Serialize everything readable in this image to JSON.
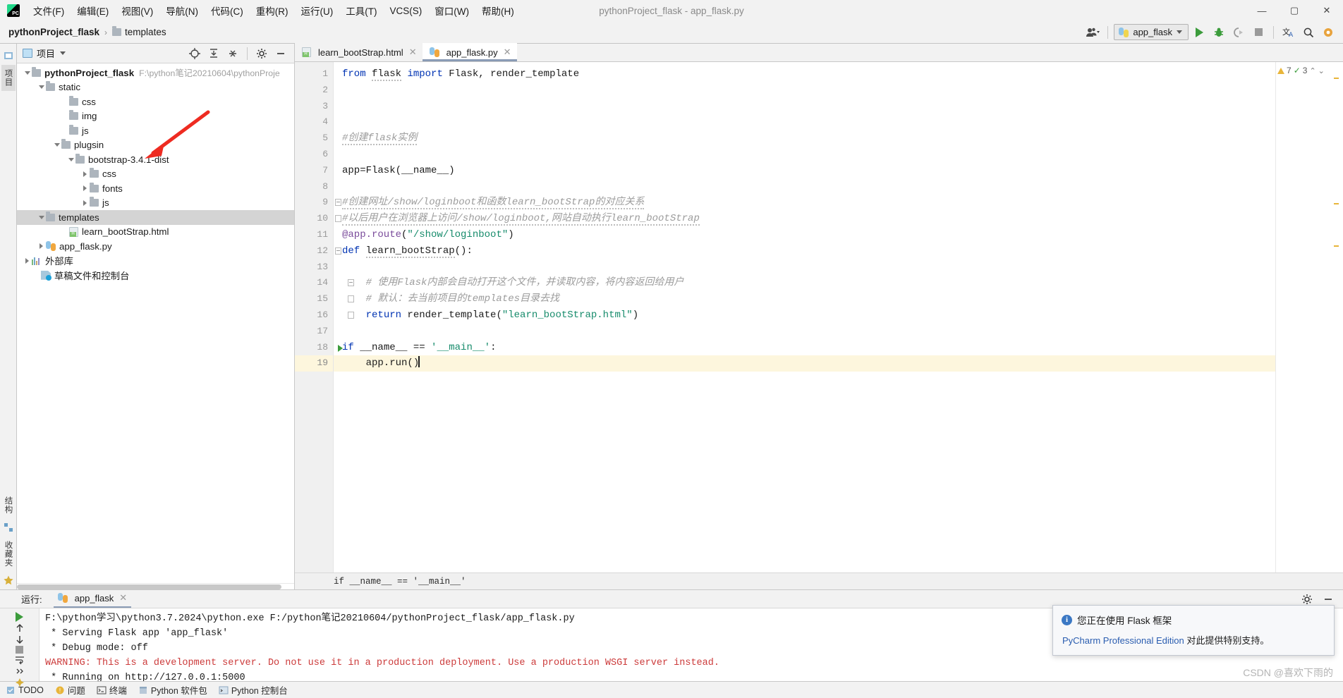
{
  "window": {
    "title": "pythonProject_flask - app_flask.py",
    "minimize": "—",
    "maximize": "▢",
    "close": "✕"
  },
  "menu": {
    "items": [
      {
        "label": "文件(F)"
      },
      {
        "label": "编辑(E)"
      },
      {
        "label": "视图(V)"
      },
      {
        "label": "导航(N)"
      },
      {
        "label": "代码(C)"
      },
      {
        "label": "重构(R)"
      },
      {
        "label": "运行(U)"
      },
      {
        "label": "工具(T)"
      },
      {
        "label": "VCS(S)"
      },
      {
        "label": "窗口(W)"
      },
      {
        "label": "帮助(H)"
      }
    ]
  },
  "navbar": {
    "crumb_project": "pythonProject_flask",
    "crumb_sep": "›",
    "crumb_folder": "templates",
    "run_config": "app_flask",
    "icons": {
      "user": "user-icon",
      "python": "python-icon",
      "run": "run-icon",
      "debug": "debug-icon",
      "coverage": "coverage-icon",
      "stop": "stop-icon",
      "translate": "translate-icon",
      "search": "search-icon",
      "settings": "settings-icon"
    }
  },
  "left_strip": {
    "items": [
      {
        "label": "项目",
        "active": true
      },
      {
        "label": "结构"
      },
      {
        "label": "收藏夹"
      }
    ]
  },
  "project_panel": {
    "title": "项目",
    "header_icons": [
      "locate-icon",
      "expand-all-icon",
      "collapse-all-icon",
      "gear-icon",
      "hide-icon"
    ],
    "tree": [
      {
        "depth": 0,
        "arrow": "down",
        "icon": "folder-icon",
        "label": "pythonProject_flask",
        "bold": true,
        "path": "F:\\python笔记20210604\\pythonProje"
      },
      {
        "depth": 1,
        "arrow": "down",
        "icon": "folder-icon",
        "label": "static"
      },
      {
        "depth": 2,
        "arrow": "none",
        "icon": "folder-icon",
        "label": "css"
      },
      {
        "depth": 2,
        "arrow": "none",
        "icon": "folder-icon",
        "label": "img"
      },
      {
        "depth": 2,
        "arrow": "none",
        "icon": "folder-icon",
        "label": "js"
      },
      {
        "depth": 1,
        "arrow": "down",
        "icon": "folder-icon",
        "label": "plugsin"
      },
      {
        "depth": 2,
        "arrow": "down",
        "icon": "folder-icon",
        "label": "bootstrap-3.4.1-dist"
      },
      {
        "depth": 3,
        "arrow": "right",
        "icon": "folder-icon",
        "label": "css"
      },
      {
        "depth": 3,
        "arrow": "right",
        "icon": "folder-icon",
        "label": "fonts"
      },
      {
        "depth": 3,
        "arrow": "right",
        "icon": "folder-icon",
        "label": "js"
      },
      {
        "depth": 1,
        "arrow": "down",
        "icon": "folder-icon",
        "label": "templates",
        "selected": true
      },
      {
        "depth": 2,
        "arrow": "none",
        "icon": "html-icon",
        "label": "learn_bootStrap.html"
      },
      {
        "depth": 1,
        "arrow": "right",
        "icon": "python-file-icon",
        "label": "app_flask.py"
      },
      {
        "depth": 0,
        "arrow": "right",
        "icon": "library-icon",
        "label": "外部库"
      },
      {
        "depth": 0,
        "arrow": "none",
        "icon": "scratch-icon",
        "label": "草稿文件和控制台"
      }
    ]
  },
  "editor": {
    "tabs": [
      {
        "label": "learn_bootStrap.html",
        "icon": "html-icon",
        "active": false,
        "close": "✕"
      },
      {
        "label": "app_flask.py",
        "icon": "python-file-icon",
        "active": true,
        "close": "✕"
      }
    ],
    "inspection": {
      "warnings": "7",
      "errors": "3",
      "warn_icon": "warning-triangle-icon",
      "ok_icon": "check-icon"
    },
    "breadcrumb_status": "if __name__ == '__main__'",
    "lines": [
      {
        "n": "1",
        "segments": [
          {
            "t": "from ",
            "c": "k"
          },
          {
            "t": "flask",
            "c": "plain squig"
          },
          {
            "t": " ",
            "c": "plain"
          },
          {
            "t": "import",
            "c": "k"
          },
          {
            "t": " Flask, render_template",
            "c": "plain"
          }
        ]
      },
      {
        "n": "2",
        "segments": []
      },
      {
        "n": "3",
        "segments": []
      },
      {
        "n": "4",
        "segments": []
      },
      {
        "n": "5",
        "segments": [
          {
            "t": "#创建flask实例",
            "c": "cm"
          }
        ]
      },
      {
        "n": "6",
        "segments": []
      },
      {
        "n": "7",
        "segments": [
          {
            "t": "app=Flask(__name__)",
            "c": "plain"
          }
        ]
      },
      {
        "n": "8",
        "segments": []
      },
      {
        "n": "9",
        "segments": [
          {
            "t": "#创建网址/show/loginboot和函数learn_bootStrap的对应关系",
            "c": "cm"
          }
        ],
        "fold": "open"
      },
      {
        "n": "10",
        "segments": [
          {
            "t": "#以后用户在浏览器上访问/show/loginboot,网站自动执行learn_bootStrap",
            "c": "cm"
          }
        ],
        "fold": "end"
      },
      {
        "n": "11",
        "segments": [
          {
            "t": "@app.route",
            "c": "dec"
          },
          {
            "t": "(",
            "c": "plain"
          },
          {
            "t": "\"/show/loginboot\"",
            "c": "s"
          },
          {
            "t": ")",
            "c": "plain"
          }
        ]
      },
      {
        "n": "12",
        "segments": [
          {
            "t": "def ",
            "c": "k"
          },
          {
            "t": "learn_bootStrap",
            "c": "fn"
          },
          {
            "t": "():",
            "c": "plain"
          }
        ],
        "fold": "open"
      },
      {
        "n": "13",
        "segments": []
      },
      {
        "n": "14",
        "segments": [
          {
            "t": "    # 使用Flask内部会自动打开这个文件，并读取内容，将内容返回给用户",
            "c": "cm"
          }
        ],
        "fold": "open"
      },
      {
        "n": "15",
        "segments": [
          {
            "t": "    # 默认：去当前项目的templates目录去找",
            "c": "cm"
          }
        ],
        "fold": "end"
      },
      {
        "n": "16",
        "segments": [
          {
            "t": "    ",
            "c": "plain"
          },
          {
            "t": "return ",
            "c": "k"
          },
          {
            "t": "render_template(",
            "c": "plain"
          },
          {
            "t": "\"learn_bootStrap.html\"",
            "c": "s"
          },
          {
            "t": ")",
            "c": "plain"
          }
        ],
        "fold": "end"
      },
      {
        "n": "17",
        "segments": []
      },
      {
        "n": "18",
        "segments": [
          {
            "t": "if ",
            "c": "k"
          },
          {
            "t": "__name__ == ",
            "c": "plain"
          },
          {
            "t": "'__main__'",
            "c": "s"
          },
          {
            "t": ":",
            "c": "plain"
          }
        ],
        "marker": "run"
      },
      {
        "n": "19",
        "segments": [
          {
            "t": "    app.run()",
            "c": "plain"
          }
        ],
        "current": true,
        "marker": "bulb"
      }
    ]
  },
  "run_panel": {
    "label": "运行:",
    "tab": "app_flask",
    "tab_close": "✕",
    "tab_icon": "python-file-icon",
    "settings_icon": "gear-icon",
    "hide_icon": "hide-icon",
    "side_buttons": [
      "rerun-icon",
      "up-arrow-icon",
      "down-arrow-icon",
      "stop-icon",
      "soft-wrap-icon",
      "expand-icon",
      "pin-icon"
    ],
    "console": [
      {
        "text": "F:\\python学习\\python3.7.2024\\python.exe F:/python笔记20210604/pythonProject_flask/app_flask.py",
        "cls": "c-path"
      },
      {
        "text": " * Serving Flask app 'app_flask'",
        "cls": "c-path"
      },
      {
        "text": " * Debug mode: off",
        "cls": "c-path"
      },
      {
        "text": "WARNING: This is a development server. Do not use it in a production deployment. Use a production WSGI server instead.",
        "cls": "c-warn"
      },
      {
        "text": " * Running on http://127.0.0.1:5000",
        "cls": "c-path"
      }
    ]
  },
  "notification": {
    "icon": "info-icon",
    "title": "您正在使用 Flask 框架",
    "link": "PyCharm Professional Edition",
    "body_rest": " 对此提供特别支持。"
  },
  "status_bar": {
    "items": [
      {
        "label": "TODO",
        "icon": "todo-icon"
      },
      {
        "label": "问题",
        "icon": "problems-icon"
      },
      {
        "label": "终端",
        "icon": "terminal-icon"
      },
      {
        "label": "Python 软件包",
        "icon": "package-icon"
      },
      {
        "label": "Python 控制台",
        "icon": "console-icon"
      }
    ]
  },
  "watermark": "CSDN @喜欢下雨的",
  "colors": {
    "accent": "#2a5db0",
    "keyword": "#0033b3",
    "string": "#168b6b",
    "comment": "#9c9c9c",
    "decorator": "#7a4b9b",
    "error": "#cc3b3b",
    "selection": "#d4d4d4",
    "current_line": "#fdf6dd",
    "annotation_arrow": "#ee2b21"
  }
}
